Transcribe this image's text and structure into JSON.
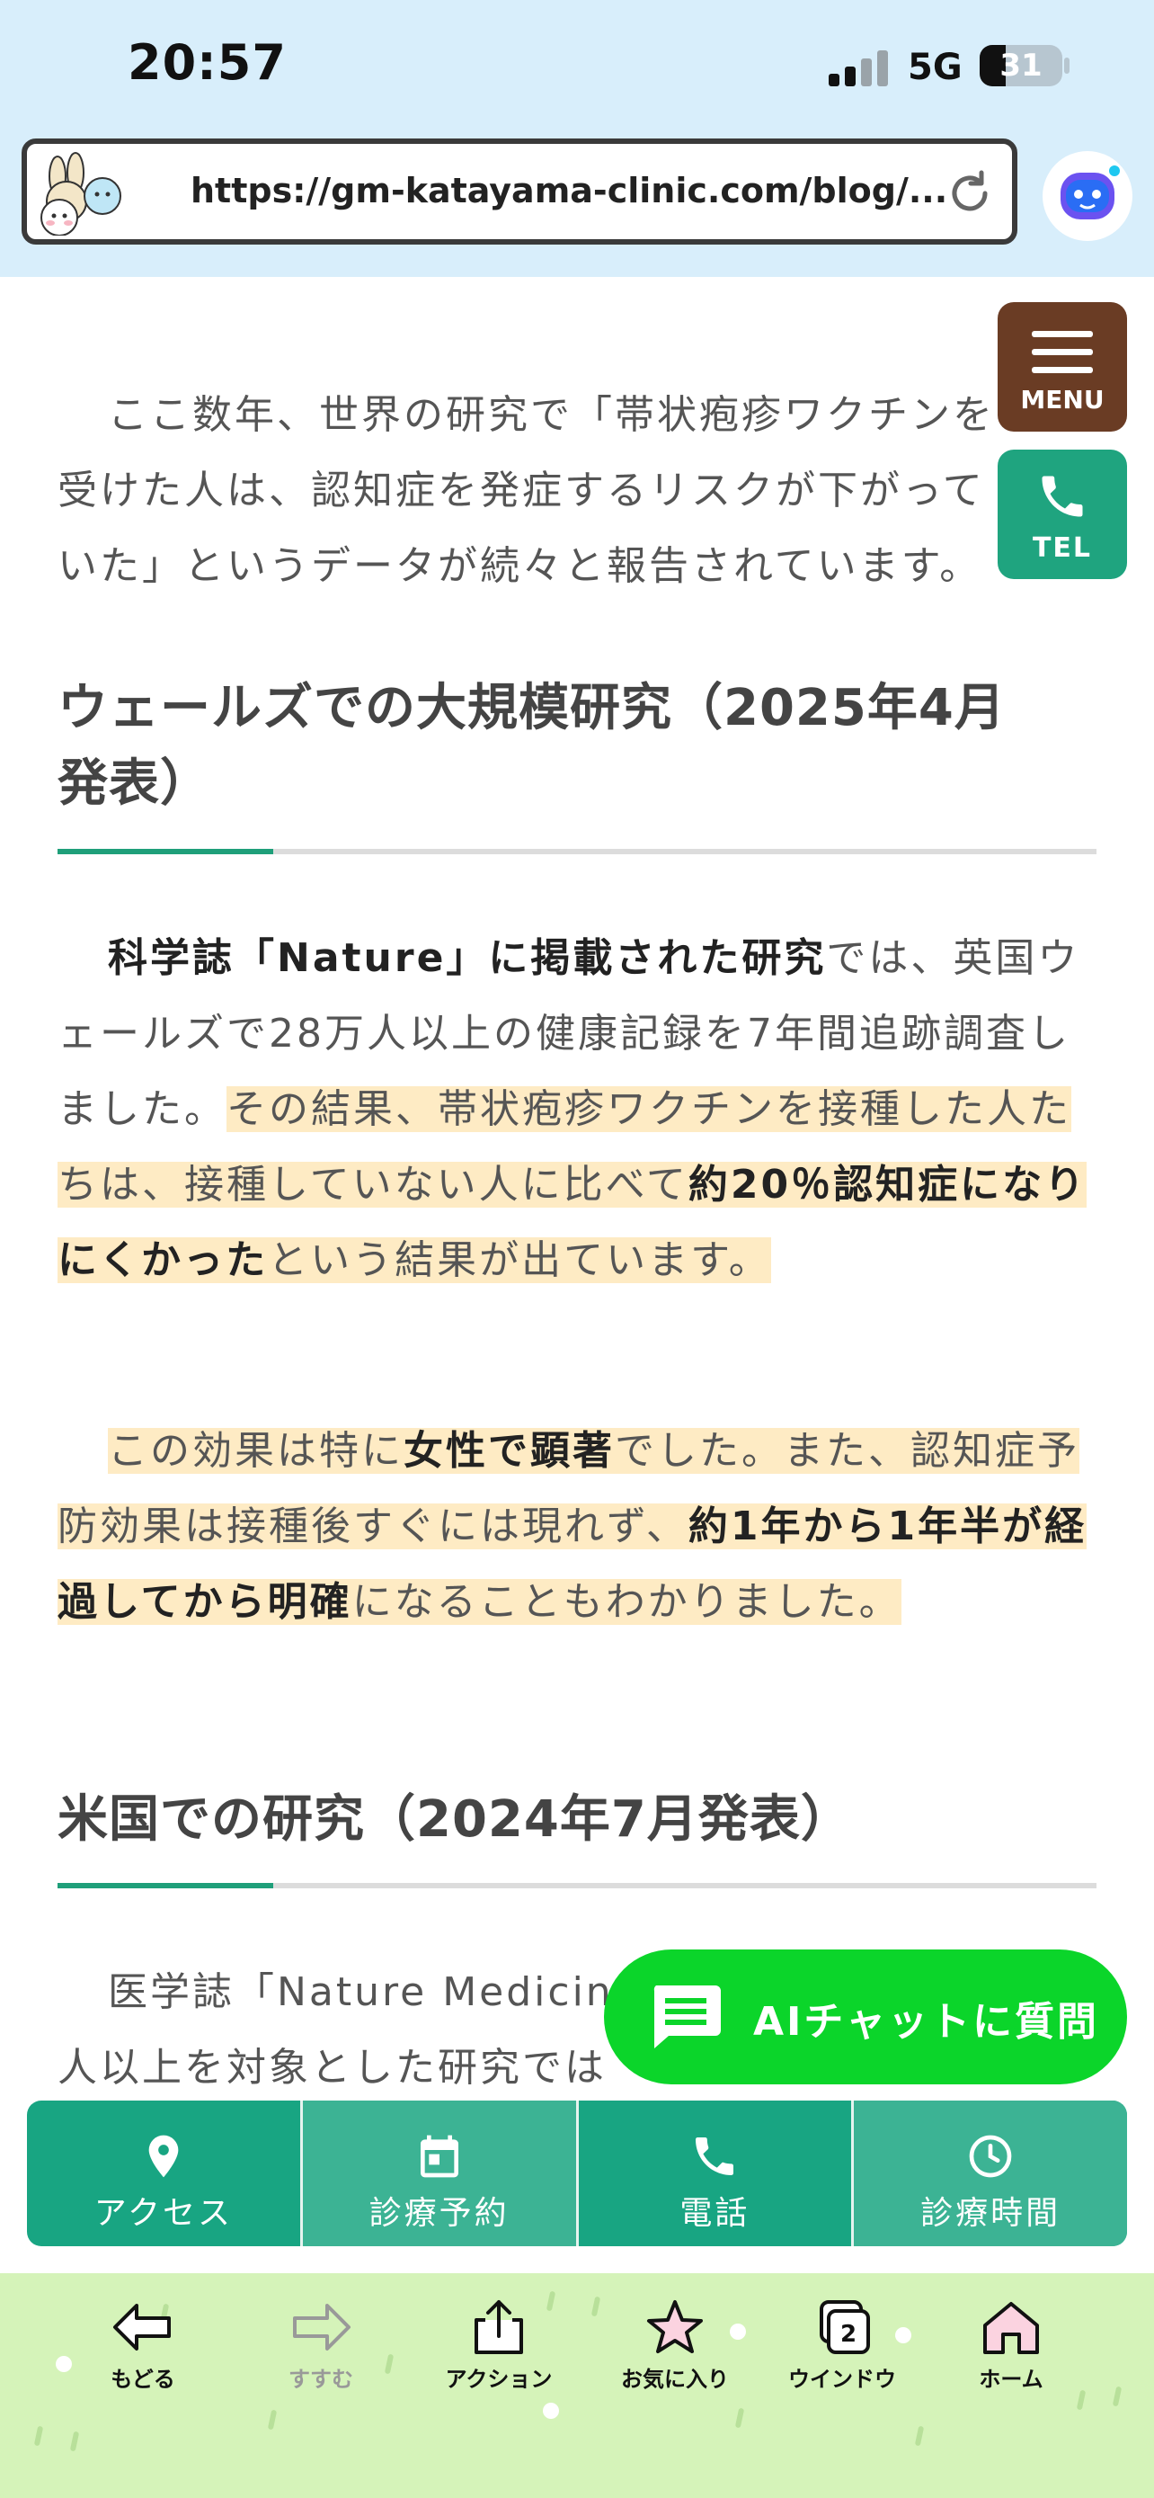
{
  "status_bar": {
    "time": "20:57",
    "network": "5G",
    "battery": "31",
    "battery_level": 0.31
  },
  "browser": {
    "url": "https://gm-katayama-clinic.com/blog/...",
    "reload_icon": "reload-icon",
    "assistant_icon": "robot-assistant-icon"
  },
  "floating": {
    "menu_label": "MENU",
    "tel_label": "TEL"
  },
  "article": {
    "intro": {
      "line1": "ここ数年、世界の研究で「帯状疱疹ワクチンを",
      "line2": "受けた人は、認知症を発症するリスクが下がって",
      "line3": "いた」というデータが続々と報告されています。"
    },
    "section1": {
      "heading_line1": "ウェールズでの大規模研究（2025年4月",
      "heading_line2": "発表）",
      "para1": {
        "bold_lead": "科学誌「Nature」に掲載された研究",
        "text1": "では、英国ウェールズで28万人以上の健康記録を7年間追跡調査しました。",
        "hl_text1": "その結果、帯状疱疹ワクチンを接種した人たちは、接種していない人に比べて",
        "hl_bold": "約20％認知症になりにくかった",
        "hl_text2": "という結果が出ています。"
      },
      "para2": {
        "t1": "この効果は特に",
        "b1": "女性で顕著",
        "t2": "でした。また、認知症予防効果は接種後すぐには現れず、",
        "b2": "約1年から1年半が経過してから明確",
        "t3": "になることもわかりました。"
      }
    },
    "section2": {
      "heading": "米国での研究（2024年7月発表）",
      "para_line1": "医学誌「Nature Medicine」",
      "para_line2": "人以上を対象とした研究では"
    }
  },
  "ai_chat": {
    "label": "AIチャットに質問",
    "icon": "chat-bubble-icon"
  },
  "site_nav": [
    {
      "label": "アクセス",
      "icon": "map-pin-icon"
    },
    {
      "label": "診療予約",
      "icon": "calendar-icon"
    },
    {
      "label": "電話",
      "icon": "phone-icon"
    },
    {
      "label": "診療時間",
      "icon": "clock-icon"
    }
  ],
  "toolbar": [
    {
      "label": "もどる",
      "icon": "back-arrow-icon"
    },
    {
      "label": "すすむ",
      "icon": "forward-arrow-icon"
    },
    {
      "label": "アクション",
      "icon": "share-icon"
    },
    {
      "label": "お気に入り",
      "icon": "star-icon"
    },
    {
      "label": "ウインドウ",
      "icon": "windows-icon",
      "count": "2"
    },
    {
      "label": "ホーム",
      "icon": "home-icon"
    }
  ],
  "colors": {
    "accent_green": "#1fa47f",
    "menu_brown": "#6a3c24",
    "highlight": "#feebc4",
    "ai_chat_green": "#0bd52a",
    "toolbar_bg": "#d5f3b9"
  }
}
